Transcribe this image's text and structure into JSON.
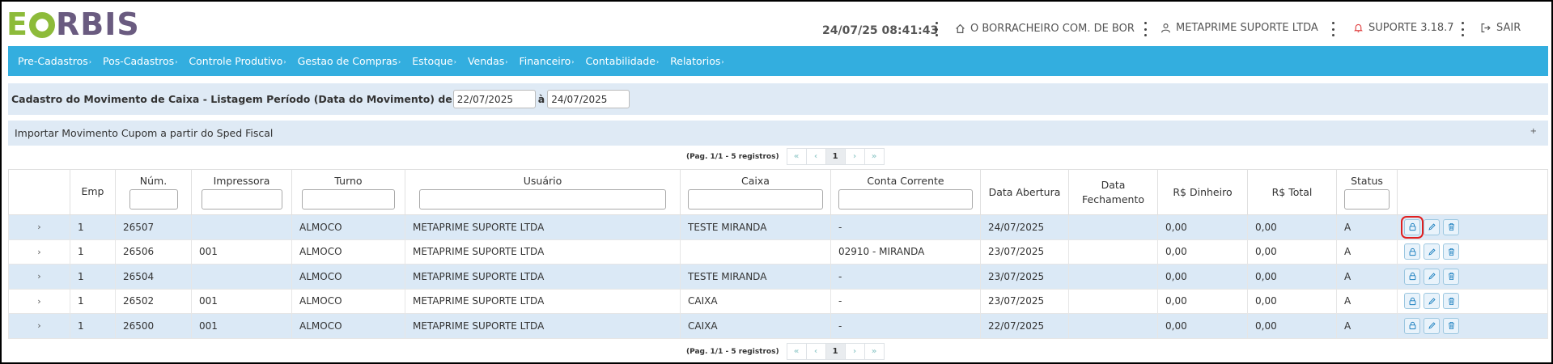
{
  "logo": {
    "part1": "E",
    "part2": "RBIS"
  },
  "header": {
    "datetime": "24/07/25 08:41:43",
    "company": "O BORRACHEIRO COM. DE BOR",
    "user": "METAPRIME SUPORTE LTDA",
    "support": "SUPORTE 3.18.7",
    "logout": "SAIR"
  },
  "menu": [
    "Pre-Cadastros",
    "Pos-Cadastros",
    "Controle Produtivo",
    "Gestao de Compras",
    "Estoque",
    "Vendas",
    "Financeiro",
    "Contabilidade",
    "Relatorios"
  ],
  "filter": {
    "title": "Cadastro do Movimento de Caixa - Listagem Período (Data do Movimento) de",
    "date_from": "22/07/2025",
    "sep": "à",
    "date_to": "24/07/2025"
  },
  "import": {
    "label": "Importar Movimento Cupom a partir do Sped Fiscal",
    "toggle": "+"
  },
  "pagination": {
    "info": "(Pag. 1/1 - 5 registros)",
    "first": "«",
    "prev": "‹",
    "page": "1",
    "next": "›",
    "last": "»"
  },
  "table": {
    "headers": [
      "Emp",
      "Núm.",
      "Impressora",
      "Turno",
      "Usuário",
      "Caixa",
      "Conta Corrente",
      "Data Abertura",
      "Data Fechamento",
      "R$ Dinheiro",
      "R$ Total",
      "Status"
    ],
    "rows": [
      [
        "1",
        "26507",
        "",
        "ALMOCO",
        "METAPRIME SUPORTE LTDA",
        "TESTE MIRANDA",
        "-",
        "24/07/2025",
        "",
        "0,00",
        "0,00",
        "A"
      ],
      [
        "1",
        "26506",
        "001",
        "ALMOCO",
        "METAPRIME SUPORTE LTDA",
        "",
        "02910 - MIRANDA",
        "23/07/2025",
        "",
        "0,00",
        "0,00",
        "A"
      ],
      [
        "1",
        "26504",
        "",
        "ALMOCO",
        "METAPRIME SUPORTE LTDA",
        "TESTE MIRANDA",
        "-",
        "23/07/2025",
        "",
        "0,00",
        "0,00",
        "A"
      ],
      [
        "1",
        "26502",
        "001",
        "ALMOCO",
        "METAPRIME SUPORTE LTDA",
        "CAIXA",
        "-",
        "23/07/2025",
        "",
        "0,00",
        "0,00",
        "A"
      ],
      [
        "1",
        "26500",
        "001",
        "ALMOCO",
        "METAPRIME SUPORTE LTDA",
        "CAIXA",
        "-",
        "22/07/2025",
        "",
        "0,00",
        "0,00",
        "A"
      ]
    ],
    "expand_icon": "›"
  },
  "colors": {
    "menu_bg": "#33aedf",
    "row_alt": "#dbe9f6",
    "panel_bg": "#dfeaf5",
    "highlight": "#e02020"
  }
}
